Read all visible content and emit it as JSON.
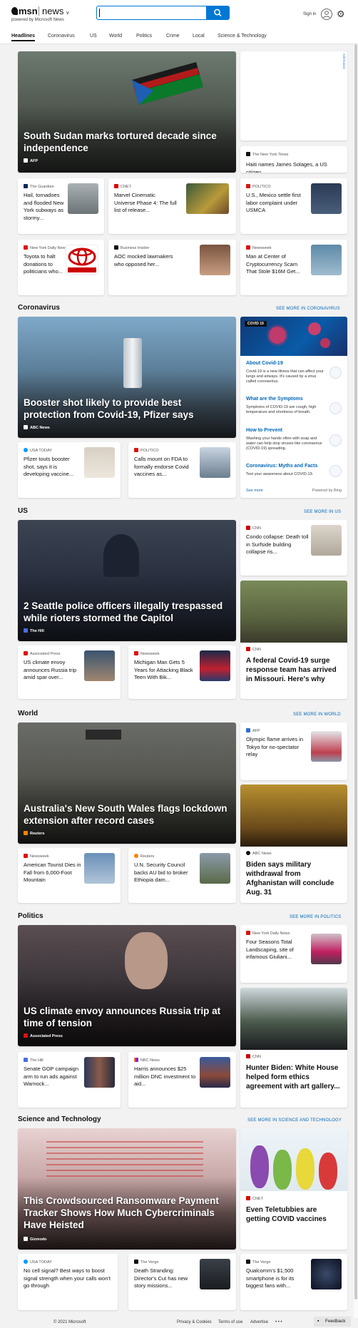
{
  "header": {
    "brand": "msn",
    "product": "news",
    "chevron": "v",
    "powered": "powered by Microsoft News",
    "search_value": "",
    "signin": "Sign in"
  },
  "nav": [
    "Headlines",
    "Coronavirus",
    "US",
    "World",
    "Politics",
    "Crime",
    "Local",
    "Science & Technology"
  ],
  "ad": {
    "label": "AdChoices"
  },
  "top": {
    "hero": {
      "title": "South Sudan marks tortured decade since independence",
      "source": "AFP"
    },
    "side": {
      "source": "The New York Times",
      "title": "Haiti names James Solages, a US citizen,..."
    },
    "cards": [
      {
        "source": "The Guardian",
        "title": "Hail, tornadoes and flooded New York subways as stormy..."
      },
      {
        "source": "CNET",
        "title": "Marvel Cinematic Universe Phase 4: The full list of release..."
      },
      {
        "source": "POLITICO",
        "title": "U.S., Mexico settle first labor complaint under USMCA"
      },
      {
        "source": "New York Daily News",
        "title": "Toyota to halt donations to politicians who..."
      },
      {
        "source": "Business Insider",
        "title": "AOC mocked lawmakers who opposed her..."
      },
      {
        "source": "Newsweek",
        "title": "Man at Center of Cryptocurrency Scam That Stole $16M Get..."
      }
    ]
  },
  "coronavirus": {
    "heading": "Coronavirus",
    "see_more": "SEE MORE IN CORONAVIRUS",
    "hero": {
      "title": "Booster shot likely to provide best protection from Covid-19, Pfizer says",
      "source": "ABC News"
    },
    "cards": [
      {
        "source": "USA TODAY",
        "title": "Pfizer touts booster shot, says it is developing vaccine..."
      },
      {
        "source": "POLITICO",
        "title": "Calls mount on FDA to formally endorse Covid vaccines as..."
      }
    ],
    "info": {
      "badge": "COVID 19",
      "items": [
        {
          "title": "About Covid-19",
          "text": "Covid-19 is a new illness that can affect your lungs and airways. It's caused by a virus called coronavirus."
        },
        {
          "title": "What are the Symptoms",
          "text": "Symptoms of COVID-19 are cough, high temperature and shortness of breath."
        },
        {
          "title": "How to Prevent",
          "text": "Washing your hands often with soap and water can help stop viruses like coronavirus (COVID-19) spreading."
        },
        {
          "title": "Coronavirus: Myths and Facts",
          "text": "Test your awareness about COVID-19."
        }
      ],
      "see_more": "See more",
      "powered": "Powered by Bing"
    }
  },
  "us": {
    "heading": "US",
    "see_more": "SEE MORE IN US",
    "hero": {
      "title": "2 Seattle police officers illegally trespassed while rioters stormed the Capitol",
      "source": "The Hill"
    },
    "side": {
      "source": "CNN",
      "title": "Condo collapse: Death toll in Surfside building collapse ris..."
    },
    "big": {
      "source": "CNN",
      "title": "A federal Covid-19 surge response team has arrived in Missouri. Here's why"
    },
    "cards": [
      {
        "source": "Associated Press",
        "title": "US climate envoy announces Russia trip amid spar over..."
      },
      {
        "source": "Newsweek",
        "title": "Michigan Man Gets 5 Years for Attacking Black Teen With Bik..."
      }
    ]
  },
  "world": {
    "heading": "World",
    "see_more": "SEE MORE IN WORLD",
    "hero": {
      "title": "Australia's New South Wales flags lockdown extension after record cases",
      "source": "Reuters"
    },
    "side": {
      "source": "AFP",
      "title": "Olympic flame arrives in Tokyo for no-spectator relay"
    },
    "big": {
      "source": "ABC News",
      "title": "Biden says military withdrawal from Afghanistan will conclude Aug. 31"
    },
    "cards": [
      {
        "source": "Newsweek",
        "title": "American Tourist Dies in Fall from 6,000-Foot Mountain"
      },
      {
        "source": "Reuters",
        "title": "U.N. Security Council backs AU bid to broker Ethiopia dam..."
      }
    ]
  },
  "politics": {
    "heading": "Politics",
    "see_more": "SEE MORE IN POLITICS",
    "hero": {
      "title": "US climate envoy announces Russia trip at time of tension",
      "source": "Associated Press"
    },
    "side": {
      "source": "New York Daily News",
      "title": "Four Seasons Total Landscaping, site of infamous Giuliani..."
    },
    "big": {
      "source": "CNN",
      "title": "Hunter Biden: White House helped form ethics agreement with art gallery..."
    },
    "cards": [
      {
        "source": "The Hill",
        "title": "Senate GOP campaign arm to run ads against Warnock..."
      },
      {
        "source": "NBC News",
        "title": "Harris announces $25 million DNC investment to aid..."
      }
    ]
  },
  "science": {
    "heading": "Science and Technology",
    "see_more": "SEE MORE IN SCIENCE AND TECHNOLOGY",
    "hero": {
      "title": "This Crowdsourced Ransomware Payment Tracker Shows How Much Cybercriminals Have Heisted",
      "source": "Gizmodo"
    },
    "big": {
      "source": "CNET",
      "title": "Even Teletubbies are getting COVID vaccines"
    },
    "cards": [
      {
        "source": "USA TODAY",
        "title": "No cell signal? Best ways to boost signal strength when your calls won't go through"
      },
      {
        "source": "The Verge",
        "title": "Death Stranding: Director's Cut has new story missions..."
      },
      {
        "source": "The Verge",
        "title": "Qualcomm's $1,500 smartphone is for its biggest fans with..."
      }
    ]
  },
  "footer": {
    "copyright": "© 2021 Microsoft",
    "links": [
      "Privacy & Cookies",
      "Terms of use",
      "Advertise"
    ],
    "more": "• • •",
    "feedback": "Feedback"
  }
}
